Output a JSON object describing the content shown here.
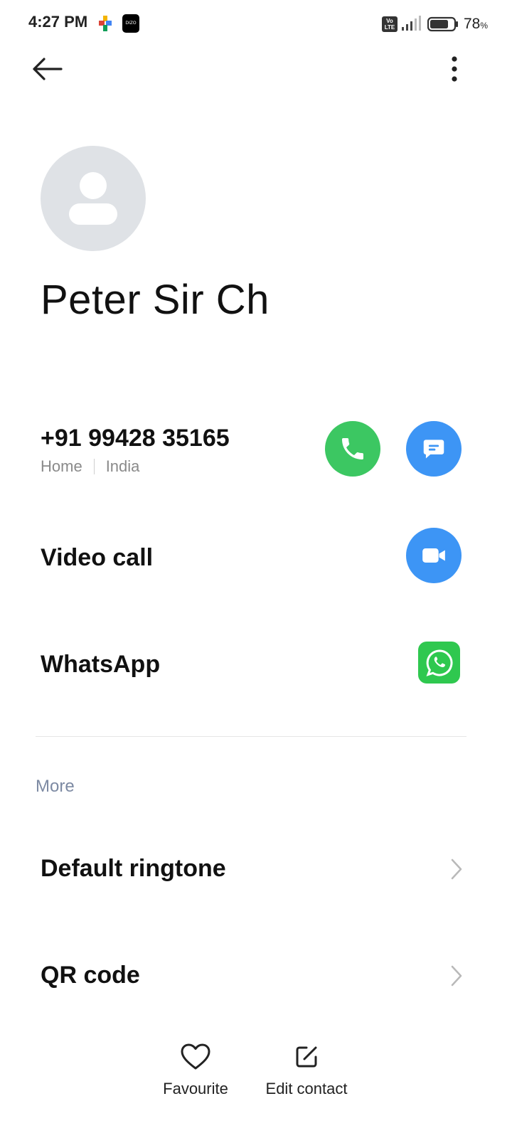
{
  "status_bar": {
    "time": "4:27 PM",
    "app_icon_b_text": "DIZO",
    "volte_text": "Vo LTE",
    "battery_level_percent": 78,
    "battery_text": "78",
    "battery_unit": "%"
  },
  "header": {
    "back_icon": "arrow-left-icon",
    "menu_icon": "more-vertical-icon"
  },
  "contact": {
    "avatar_icon": "person-placeholder-icon",
    "name": "Peter Sir Ch",
    "phone": {
      "number": "+91 99428 35165",
      "type": "Home",
      "region": "India"
    }
  },
  "actions": {
    "call_icon": "phone-icon",
    "call_color": "#3cc762",
    "message_icon": "message-icon",
    "message_color": "#3d95f5",
    "video_call_label": "Video call",
    "video_icon": "video-camera-icon",
    "whatsapp_label": "WhatsApp",
    "whatsapp_icon": "whatsapp-icon",
    "whatsapp_color": "#2fc84f"
  },
  "more_section": {
    "title": "More",
    "items": [
      {
        "label": "Default ringtone",
        "icon": "chevron-right-icon"
      },
      {
        "label": "QR code",
        "icon": "chevron-right-icon"
      }
    ]
  },
  "bottom_bar": {
    "favourite_label": "Favourite",
    "favourite_icon": "heart-icon",
    "edit_label": "Edit contact",
    "edit_icon": "edit-icon"
  }
}
